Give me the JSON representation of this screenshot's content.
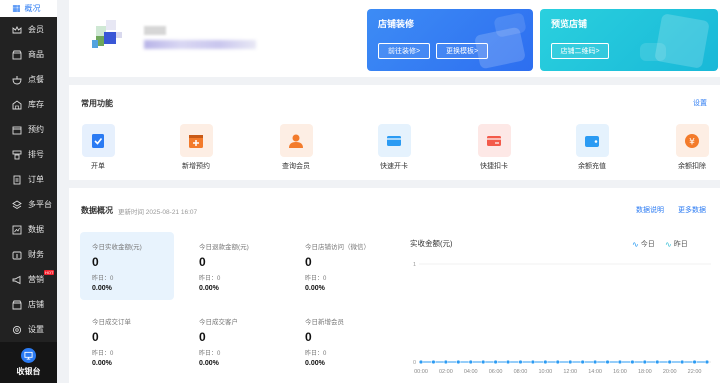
{
  "sidebar": {
    "overview": {
      "label": "概况",
      "icon": "grid-icon"
    },
    "items": [
      {
        "label": "会员",
        "icon": "crown-icon"
      },
      {
        "label": "商品",
        "icon": "shop-icon"
      },
      {
        "label": "点餐",
        "icon": "bowl-icon"
      },
      {
        "label": "库存",
        "icon": "warehouse-icon"
      },
      {
        "label": "预约",
        "icon": "calendar-icon"
      },
      {
        "label": "排号",
        "icon": "queue-icon"
      },
      {
        "label": "订单",
        "icon": "order-icon"
      },
      {
        "label": "多平台",
        "icon": "layers-icon"
      },
      {
        "label": "数据",
        "icon": "chart-icon"
      },
      {
        "label": "财务",
        "icon": "wallet-icon"
      },
      {
        "label": "营销",
        "icon": "megaphone-icon",
        "badge": "HOT"
      },
      {
        "label": "店铺",
        "icon": "store-icon"
      },
      {
        "label": "设置",
        "icon": "gear-icon"
      }
    ],
    "cashier": {
      "label": "收银台",
      "icon": "monitor-icon"
    }
  },
  "promos": {
    "decorate": {
      "title": "店铺装修",
      "btn1": "前往装修>",
      "btn2": "更换模板>"
    },
    "preview": {
      "title": "预览店铺",
      "btn1": "店铺二维码>"
    }
  },
  "functions": {
    "title": "常用功能",
    "settings": "设置",
    "items": [
      {
        "label": "开单",
        "icon": "clipboard-check-icon",
        "color": "#2b7bf3",
        "bg": "#e6f0fd"
      },
      {
        "label": "新增预约",
        "icon": "calendar-plus-icon",
        "color": "#f37b2b",
        "bg": "#fdeee4"
      },
      {
        "label": "查询会员",
        "icon": "user-icon",
        "color": "#f37b2b",
        "bg": "#fdeee4"
      },
      {
        "label": "快速开卡",
        "icon": "card-icon",
        "color": "#2b9bf3",
        "bg": "#e5f2fd"
      },
      {
        "label": "快捷扣卡",
        "icon": "card-minus-icon",
        "color": "#f35a4a",
        "bg": "#fde8e6"
      },
      {
        "label": "余额充值",
        "icon": "wallet-plus-icon",
        "color": "#2b9bf3",
        "bg": "#e5f2fd"
      },
      {
        "label": "余额扣除",
        "icon": "yen-icon",
        "color": "#f37b2b",
        "bg": "#fdeee4"
      }
    ]
  },
  "overview": {
    "title": "数据概况",
    "updated": "更新时间 2025-08-21 16:07",
    "explain": "数据说明",
    "more": "更多数据",
    "stats": [
      {
        "label": "今日实收金额(元)",
        "value": "0",
        "yesterday": "昨日：0",
        "pct": "0.00%"
      },
      {
        "label": "今日退款金额(元)",
        "value": "0",
        "yesterday": "昨日：0",
        "pct": "0.00%"
      },
      {
        "label": "今日店铺访问（微信）",
        "value": "0",
        "yesterday": "昨日：0",
        "pct": "0.00%"
      },
      {
        "label": "今日成交订单",
        "value": "0",
        "yesterday": "昨日：0",
        "pct": "0.00%"
      },
      {
        "label": "今日成交客户",
        "value": "0",
        "yesterday": "昨日：0",
        "pct": "0.00%"
      },
      {
        "label": "今日新增会员",
        "value": "0",
        "yesterday": "昨日：0",
        "pct": "0.00%"
      }
    ]
  },
  "chart_data": {
    "type": "line",
    "title": "实收金额(元)",
    "legend": [
      "今日",
      "昨日"
    ],
    "legend_position": "top-right",
    "colors": {
      "today": "#2b9bf3",
      "yesterday": "#3cc0d6"
    },
    "x": [
      "00:00",
      "01:00",
      "02:00",
      "03:00",
      "04:00",
      "05:00",
      "06:00",
      "07:00",
      "08:00",
      "09:00",
      "10:00",
      "11:00",
      "12:00",
      "13:00",
      "14:00",
      "15:00",
      "16:00",
      "17:00",
      "18:00",
      "19:00",
      "20:00",
      "21:00",
      "22:00",
      "23:00"
    ],
    "tick_labels": [
      "00:00",
      "02:00",
      "04:00",
      "06:00",
      "08:00",
      "10:00",
      "12:00",
      "14:00",
      "16:00",
      "18:00",
      "20:00",
      "22:00"
    ],
    "y_ticks": [
      "0",
      "1"
    ],
    "ylim": [
      0,
      1
    ],
    "series": [
      {
        "name": "今日",
        "values": [
          0,
          0,
          0,
          0,
          0,
          0,
          0,
          0,
          0,
          0,
          0,
          0,
          0,
          0,
          0,
          0,
          0,
          0,
          0,
          0,
          0,
          0,
          0,
          0
        ]
      }
    ]
  }
}
